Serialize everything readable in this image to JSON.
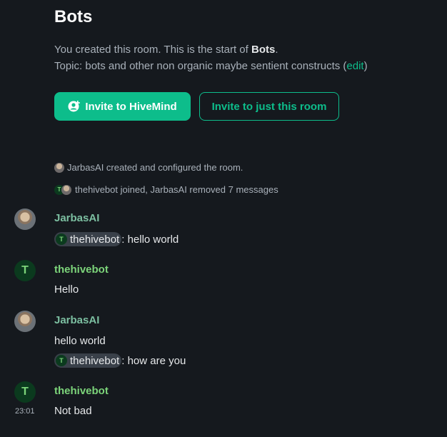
{
  "room": {
    "name": "Bots",
    "intro_prefix": "You created this room. This is the start of ",
    "intro_room": "Bots",
    "intro_suffix": ".",
    "topic_prefix": "Topic: bots and other non organic maybe sentient constructs (",
    "topic_edit": "edit",
    "topic_suffix": ")"
  },
  "buttons": {
    "invite_space": "Invite to HiveMind",
    "invite_room": "Invite to just this room"
  },
  "events": [
    {
      "text": "JarbasAI created and configured the room."
    },
    {
      "text": "thehivebot joined, JarbasAI removed 7 messages"
    }
  ],
  "messages": [
    {
      "sender": "JarbasAI",
      "mention": "thehivebot",
      "text": ": hello world"
    },
    {
      "sender": "thehivebot",
      "text": "Hello"
    },
    {
      "sender": "JarbasAI",
      "text": "hello world",
      "mention": "thehivebot",
      "text2": ": how are you"
    },
    {
      "sender": "thehivebot",
      "text": "Not bad",
      "time": "23:01"
    }
  ],
  "avatar_letter": "T",
  "colors": {
    "background": "#15191e",
    "accent": "#0dbd8b",
    "jarbas_name": "#7cbfa1",
    "hivebot_name": "#7cd47a"
  },
  "icons": {
    "invite_space": "person-plus-icon"
  }
}
